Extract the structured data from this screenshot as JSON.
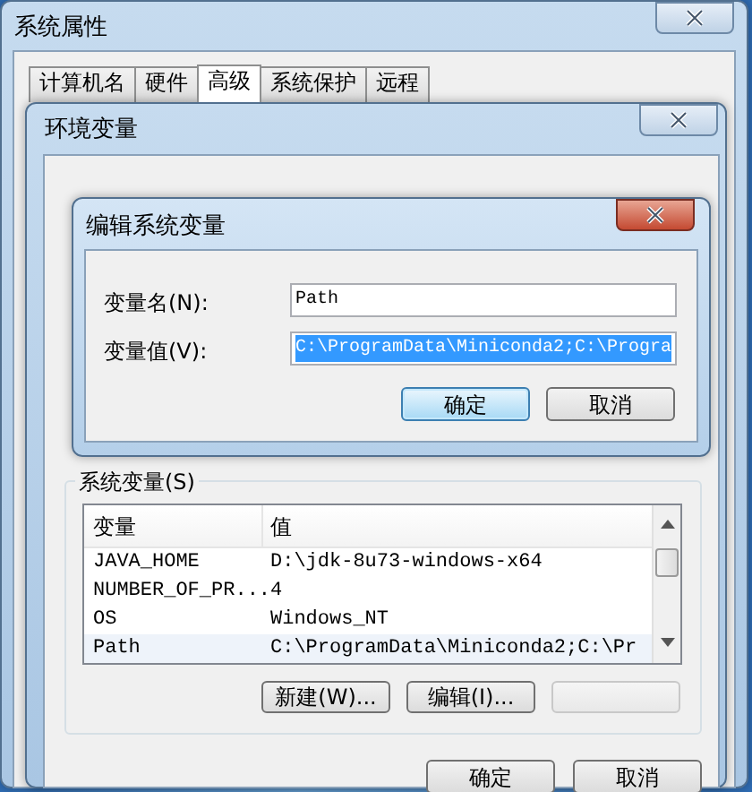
{
  "system_properties": {
    "title": "系统属性",
    "tabs": [
      {
        "label": "计算机名",
        "selected": false
      },
      {
        "label": "硬件",
        "selected": false
      },
      {
        "label": "高级",
        "selected": true
      },
      {
        "label": "系统保护",
        "selected": false
      },
      {
        "label": "远程",
        "selected": false
      }
    ]
  },
  "environment_dialog": {
    "title": "环境变量",
    "system_variables": {
      "label": "系统变量(S)",
      "columns": [
        "变量",
        "值"
      ],
      "rows": [
        {
          "name": "JAVA_HOME",
          "value": "D:\\jdk-8u73-windows-x64",
          "selected": false
        },
        {
          "name": "NUMBER_OF_PR...",
          "value": "4",
          "selected": false
        },
        {
          "name": "OS",
          "value": "Windows_NT",
          "selected": false
        },
        {
          "name": "Path",
          "value": "C:\\ProgramData\\Miniconda2;C:\\Pr",
          "selected": true
        }
      ],
      "buttons": [
        {
          "kind": "text",
          "label": "新建(W)..."
        },
        {
          "kind": "text",
          "label": "编辑(I)..."
        },
        {
          "kind": "blurred"
        }
      ]
    },
    "buttons": [
      "确定",
      "取消"
    ]
  },
  "edit_dialog": {
    "title": "编辑系统变量",
    "fields": [
      {
        "label": "变量名(N):",
        "value": "Path",
        "selected": false
      },
      {
        "label": "变量值(V):",
        "value": "C:\\ProgramData\\Miniconda2;C:\\Progra",
        "selected": true
      }
    ],
    "buttons": [
      {
        "label": "确定",
        "default": true
      },
      {
        "label": "取消",
        "default": false
      }
    ]
  }
}
